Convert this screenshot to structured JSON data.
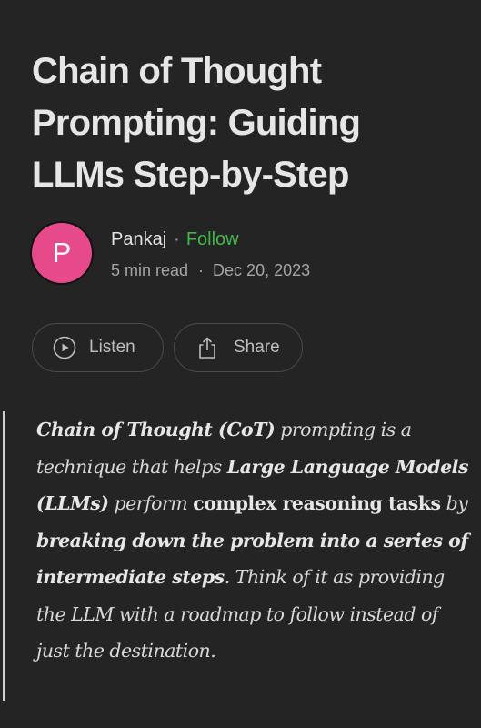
{
  "article": {
    "title": "Chain of Thought Prompting: Guiding LLMs Step-by-Step"
  },
  "author": {
    "initial": "P",
    "avatar_color": "#e64a8b",
    "name": "Pankaj",
    "separator": "·",
    "follow_label": "Follow",
    "follow_color": "#3fb84a"
  },
  "meta": {
    "read_time": "5 min read",
    "separator": "·",
    "date": "Dec 20, 2023"
  },
  "actions": {
    "listen_label": "Listen",
    "listen_icon": "play-circle-icon",
    "share_label": "Share",
    "share_icon": "share-icon"
  },
  "quote": {
    "segments": [
      {
        "text": "Chain of Thought (CoT)",
        "style": "bi"
      },
      {
        "text": " prompting is a technique that helps ",
        "style": "i"
      },
      {
        "text": "Large Language Models (LLMs)",
        "style": "bi"
      },
      {
        "text": " perform ",
        "style": "i"
      },
      {
        "text": "complex reasoning tasks",
        "style": "b"
      },
      {
        "text": " by ",
        "style": "i"
      },
      {
        "text": "breaking down the problem into a series of intermediate steps",
        "style": "bi"
      },
      {
        "text": ". Think of it as providing the LLM with a roadmap to follow instead of just the destination.",
        "style": "i"
      }
    ]
  }
}
